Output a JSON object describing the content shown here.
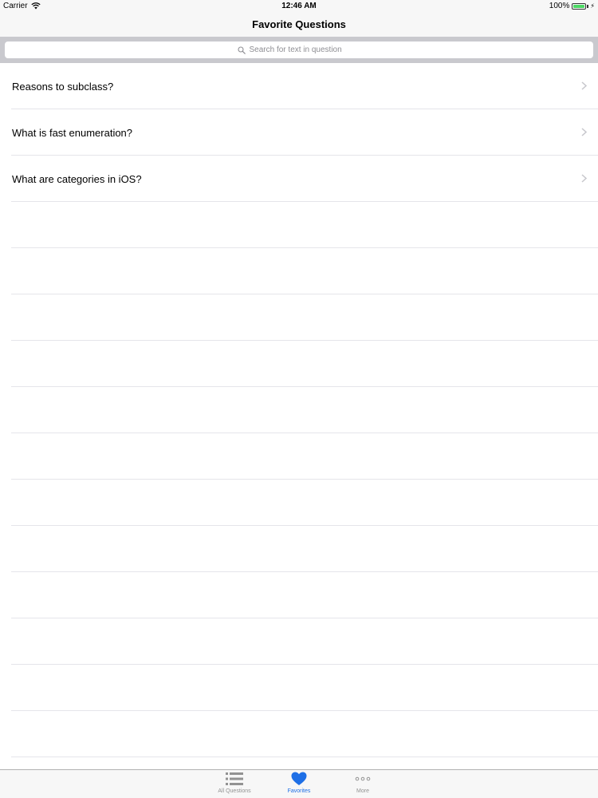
{
  "status_bar": {
    "carrier": "Carrier",
    "time": "12:46 AM",
    "battery": "100%",
    "battery_level": 1.0
  },
  "nav": {
    "title": "Favorite Questions"
  },
  "search": {
    "placeholder": "Search for text in question"
  },
  "questions": [
    {
      "label": "Reasons to subclass?"
    },
    {
      "label": "What is fast enumeration?"
    },
    {
      "label": "What are categories in iOS?"
    }
  ],
  "tab_bar": {
    "tabs": [
      {
        "label": "All Questions",
        "icon": "list-icon"
      },
      {
        "label": "Favorites",
        "icon": "heart-icon",
        "active": true
      },
      {
        "label": "More",
        "icon": "more-icon"
      }
    ]
  },
  "colors": {
    "accent": "#1e6fe6",
    "battery": "#4cd964",
    "separator": "#e5e5ea"
  }
}
